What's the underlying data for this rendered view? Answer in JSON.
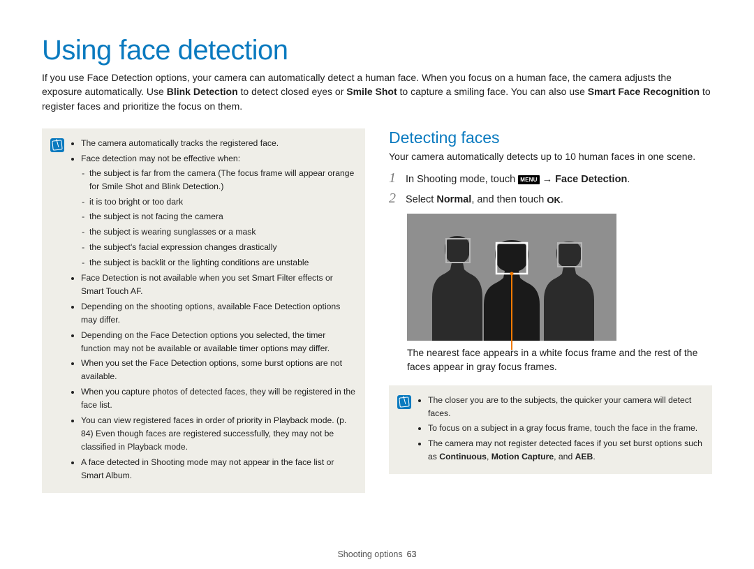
{
  "title": "Using face detection",
  "intro_parts": {
    "p1": "If you use Face Detection options, your camera can automatically detect a human face. When you focus on a human face, the camera adjusts the exposure automatically. Use ",
    "b1": "Blink Detection",
    "p2": " to detect closed eyes or ",
    "b2": "Smile Shot",
    "p3": " to capture a smiling face. You can also use ",
    "b3": "Smart Face Recognition",
    "p4": " to register faces and prioritize the focus on them."
  },
  "left_notes": {
    "li1": "The camera automatically tracks the registered face.",
    "li2": "Face detection may not be effective when:",
    "sub1": "the subject is far from the camera (The focus frame will appear orange for Smile Shot and Blink Detection.)",
    "sub2": "it is too bright or too dark",
    "sub3": "the subject is not facing the camera",
    "sub4": "the subject is wearing sunglasses or a mask",
    "sub5": "the subject's facial expression changes drastically",
    "sub6": "the subject is backlit or the lighting conditions are unstable",
    "li3": "Face Detection is not available when you set Smart Filter effects or Smart Touch AF.",
    "li4": "Depending on the shooting options, available Face Detection options may differ.",
    "li5": "Depending on the Face Detection options you selected, the timer function may not be available or available timer options may differ.",
    "li6": "When you set the Face Detection options, some burst options are not available.",
    "li7": "When you capture photos of detected faces, they will be registered in the face list.",
    "li8": "You can view registered faces in order of priority in Playback mode. (p. 84) Even though faces are registered successfully, they may not be classified in Playback mode.",
    "li9": "A face detected in Shooting mode may not appear in the face list or Smart Album."
  },
  "right": {
    "heading": "Detecting faces",
    "desc": "Your camera automatically detects up to 10 human faces in one scene.",
    "step1_a": "In Shooting mode, touch ",
    "step1_menu": "MENU",
    "step1_b": " → ",
    "step1_bold": "Face Detection",
    "step1_c": ".",
    "step2_a": "Select ",
    "step2_bold": "Normal",
    "step2_b": ", and then touch ",
    "step2_ok": "OK",
    "step2_c": ".",
    "caption": "The nearest face appears in a white focus frame and the rest of the faces appear in gray focus frames.",
    "notes": {
      "n1": "The closer you are to the subjects, the quicker your camera will detect faces.",
      "n2": "To focus on a subject in a gray focus frame, touch the face in the frame.",
      "n3a": "The camera may not register detected faces if you set burst options such as ",
      "n3b1": "Continuous",
      "n3c": ", ",
      "n3b2": "Motion Capture",
      "n3d": ", and ",
      "n3b3": "AEB",
      "n3e": "."
    }
  },
  "footer_label": "Shooting options",
  "footer_page": "63"
}
